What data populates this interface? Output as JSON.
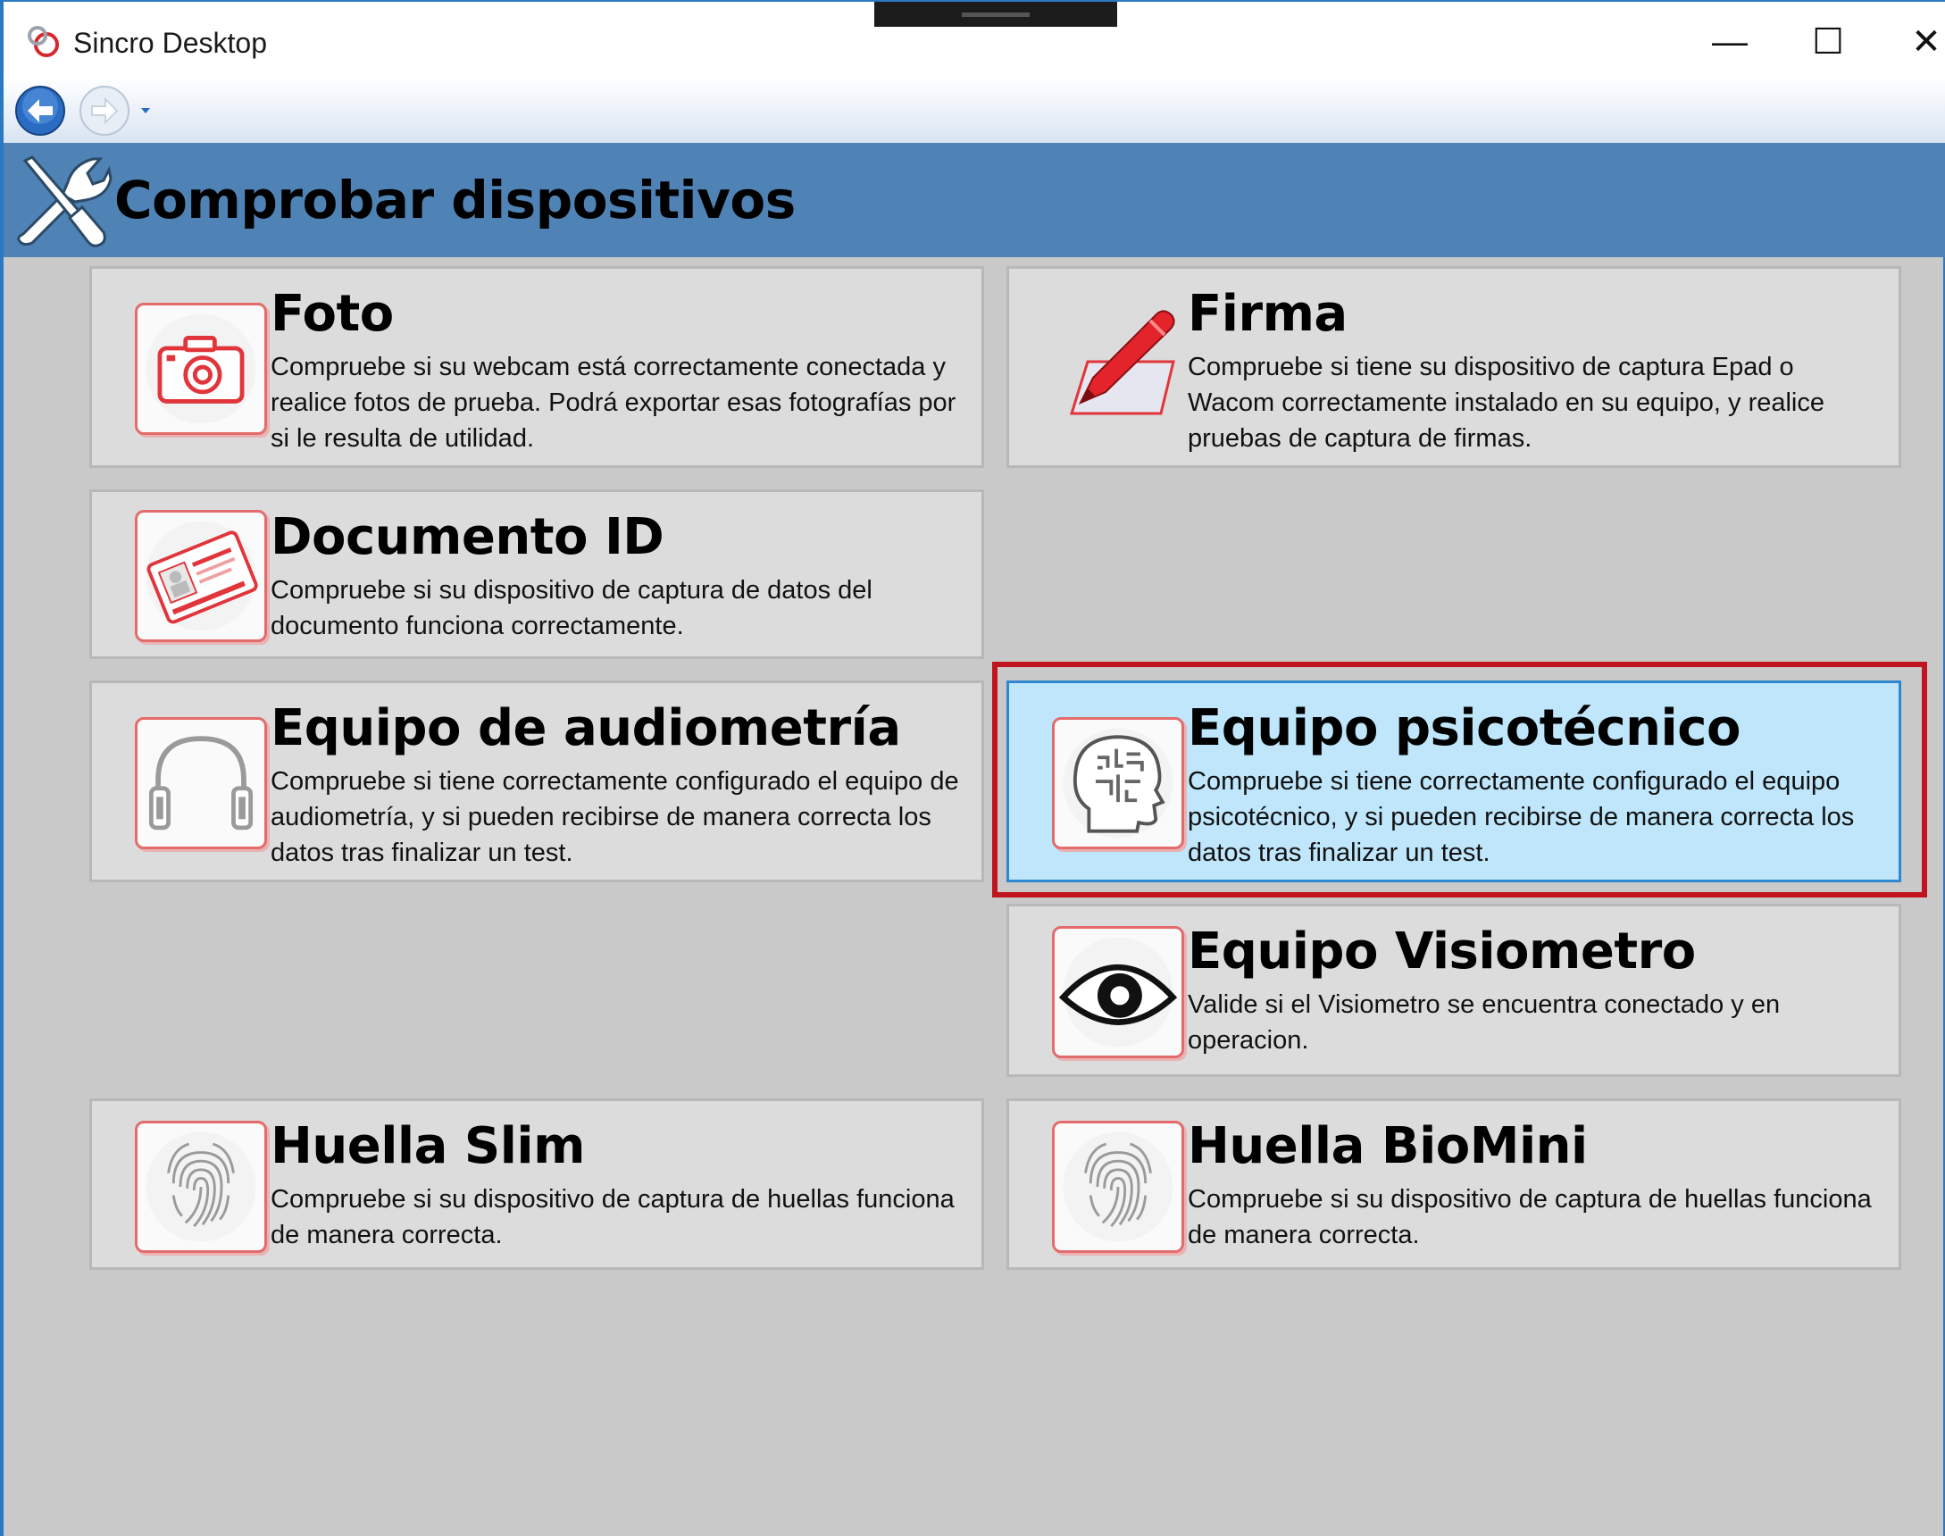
{
  "window": {
    "title": "Sincro Desktop",
    "minimize": "—",
    "maximize": "☐",
    "close": "✕"
  },
  "header": {
    "title": "Comprobar dispositivos",
    "icon": "tools-icon"
  },
  "tiles": [
    {
      "title": "Foto",
      "description": "Compruebe si su webcam está correctamente conectada y realice fotos de prueba. Podrá exportar esas fotografías por si le resulta de utilidad.",
      "icon": "camera-icon"
    },
    {
      "title": "Firma",
      "description": "Compruebe si tiene su dispositivo de captura Epad o Wacom correctamente instalado en su equipo, y realice pruebas de captura de firmas.",
      "icon": "pen-signature-icon"
    },
    {
      "title": "Documento ID",
      "description": "Compruebe si su dispositivo de captura de datos del documento funciona correctamente.",
      "icon": "id-card-icon"
    },
    {
      "title": "Equipo de audiometría",
      "description": "Compruebe si tiene correctamente configurado el equipo de audiometría, y si pueden recibirse de manera correcta los datos tras finalizar un test.",
      "icon": "headphones-icon"
    },
    {
      "title": "Equipo psicotécnico",
      "description": "Compruebe si tiene correctamente configurado el equipo psicotécnico, y si pueden recibirse de manera correcta los datos tras finalizar un test.",
      "icon": "brain-head-icon",
      "selected": true
    },
    {
      "title": "Equipo Visiometro",
      "description": "Valide si el Visiometro se encuentra conectado y en operacion.",
      "icon": "eye-icon"
    },
    {
      "title": "Huella Slim",
      "description": "Compruebe si su dispositivo de captura de huellas funciona de manera correcta.",
      "icon": "fingerprint-icon"
    },
    {
      "title": "Huella BioMini",
      "description": "Compruebe si su dispositivo de captura de huellas funciona de manera correcta.",
      "icon": "fingerprint-icon"
    }
  ],
  "colors": {
    "header_bg": "#4f83b5",
    "tile_bg": "#dcdcdc",
    "selected_bg": "#bfe6fb",
    "highlight_border": "#c0141e",
    "icon_border": "#e46b6b"
  }
}
